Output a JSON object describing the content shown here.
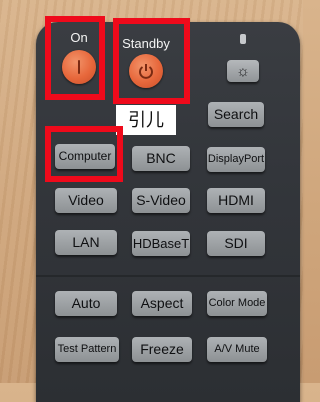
{
  "power": {
    "on_label": "On",
    "standby_label": "Standby"
  },
  "sticker_text": "引儿",
  "sun_icon": "☼",
  "buttons": {
    "search": "Search",
    "computer": "Computer",
    "bnc": "BNC",
    "displayport": "DisplayPort",
    "video": "Video",
    "s_video": "S-Video",
    "hdmi": "HDMI",
    "lan": "LAN",
    "hdbaset": "HDBaseT",
    "sdi": "SDI",
    "auto": "Auto",
    "aspect": "Aspect",
    "color_mode": "Color Mode",
    "test_pattern": "Test Pattern",
    "freeze": "Freeze",
    "av_mute": "A/V Mute"
  },
  "colors": {
    "highlight": "#ef0a1b",
    "power_button": "#e7673b",
    "remote_body": "#33363b"
  }
}
